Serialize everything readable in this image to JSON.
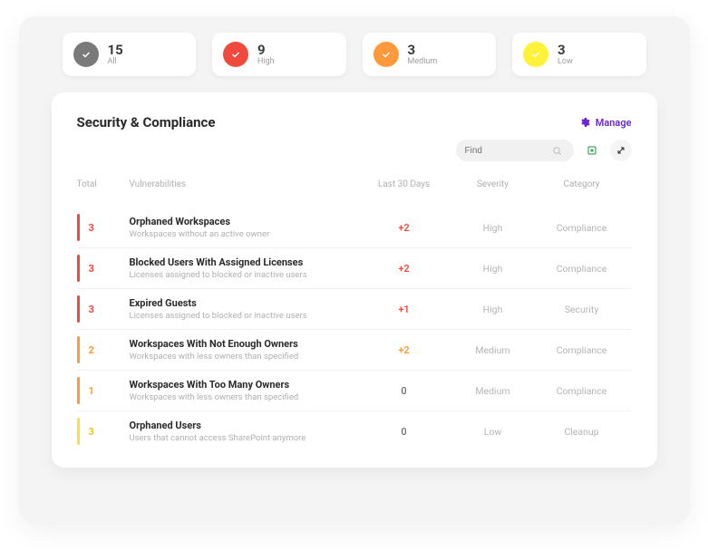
{
  "summary": {
    "all": {
      "count": "15",
      "label": "All"
    },
    "high": {
      "count": "9",
      "label": "High"
    },
    "medium": {
      "count": "3",
      "label": "Medium"
    },
    "low": {
      "count": "3",
      "label": "Low"
    }
  },
  "panel": {
    "title": "Security & Compliance",
    "manage_label": "Manage"
  },
  "search": {
    "placeholder": "Find"
  },
  "columns": {
    "total": "Total",
    "vulnerabilities": "Vulnerabilities",
    "last30": "Last 30 Days",
    "severity": "Severity",
    "category": "Category"
  },
  "rows": [
    {
      "total": "3",
      "severity_key": "high",
      "title": "Orphaned Workspaces",
      "desc": "Workspaces without an active owner",
      "last30": "+2",
      "last30_class": "pos-high",
      "severity": "High",
      "category": "Compliance"
    },
    {
      "total": "3",
      "severity_key": "high",
      "title": "Blocked Users With Assigned Licenses",
      "desc": "Licenses assigned to blocked or inactive users",
      "last30": "+2",
      "last30_class": "pos-high",
      "severity": "High",
      "category": "Compliance"
    },
    {
      "total": "3",
      "severity_key": "high",
      "title": "Expired Guests",
      "desc": "Licenses assigned to blocked or inactive users",
      "last30": "+1",
      "last30_class": "pos-high",
      "severity": "High",
      "category": "Security"
    },
    {
      "total": "2",
      "severity_key": "medium",
      "title": "Workspaces With Not Enough Owners",
      "desc": "Workspaces with less owners than specified",
      "last30": "+2",
      "last30_class": "pos-medium",
      "severity": "Medium",
      "category": "Compliance"
    },
    {
      "total": "1",
      "severity_key": "medium",
      "title": "Workspaces With Too Many Owners",
      "desc": "Workspaces with less owners than specified",
      "last30": "0",
      "last30_class": "zero",
      "severity": "Medium",
      "category": "Compliance"
    },
    {
      "total": "3",
      "severity_key": "low",
      "title": "Orphaned Users",
      "desc": "Users that cannot access SharePoint anymore",
      "last30": "0",
      "last30_class": "zero",
      "severity": "Low",
      "category": "Cleanup"
    }
  ]
}
